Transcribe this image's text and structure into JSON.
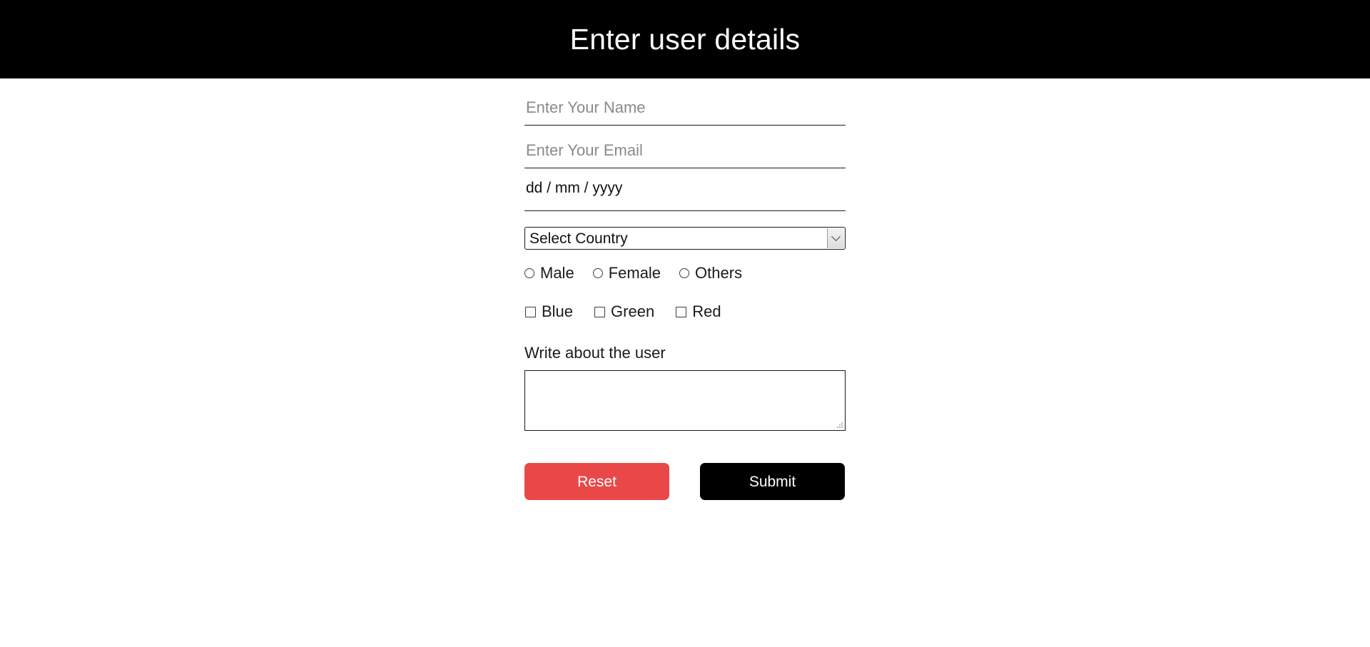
{
  "header": {
    "title": "Enter user details"
  },
  "form": {
    "name_field": {
      "placeholder": "Enter Your Name",
      "value": ""
    },
    "email_field": {
      "placeholder": "Enter Your Email",
      "value": ""
    },
    "dob_field": {
      "placeholder": "dd / mm / yyyy",
      "value": ""
    },
    "country_select": {
      "selected": "Select Country",
      "arrow_icon": "chevron-down-icon"
    },
    "gender": {
      "options": [
        {
          "label": "Male",
          "checked": false
        },
        {
          "label": "Female",
          "checked": false
        },
        {
          "label": "Others",
          "checked": false
        }
      ]
    },
    "colors": {
      "options": [
        {
          "label": "Blue",
          "checked": false
        },
        {
          "label": "Green",
          "checked": false
        },
        {
          "label": "Red",
          "checked": false
        }
      ]
    },
    "about": {
      "label": "Write about the user",
      "value": "",
      "placeholder": ""
    },
    "buttons": {
      "reset_label": "Reset",
      "submit_label": "Submit"
    }
  },
  "colors": {
    "header_bg": "#000000",
    "header_text": "#ffffff",
    "page_bg": "#ffffff",
    "reset_bg": "#ea4848",
    "submit_bg": "#000000",
    "text": "#1b1b1b",
    "placeholder": "#8a8a8a"
  }
}
